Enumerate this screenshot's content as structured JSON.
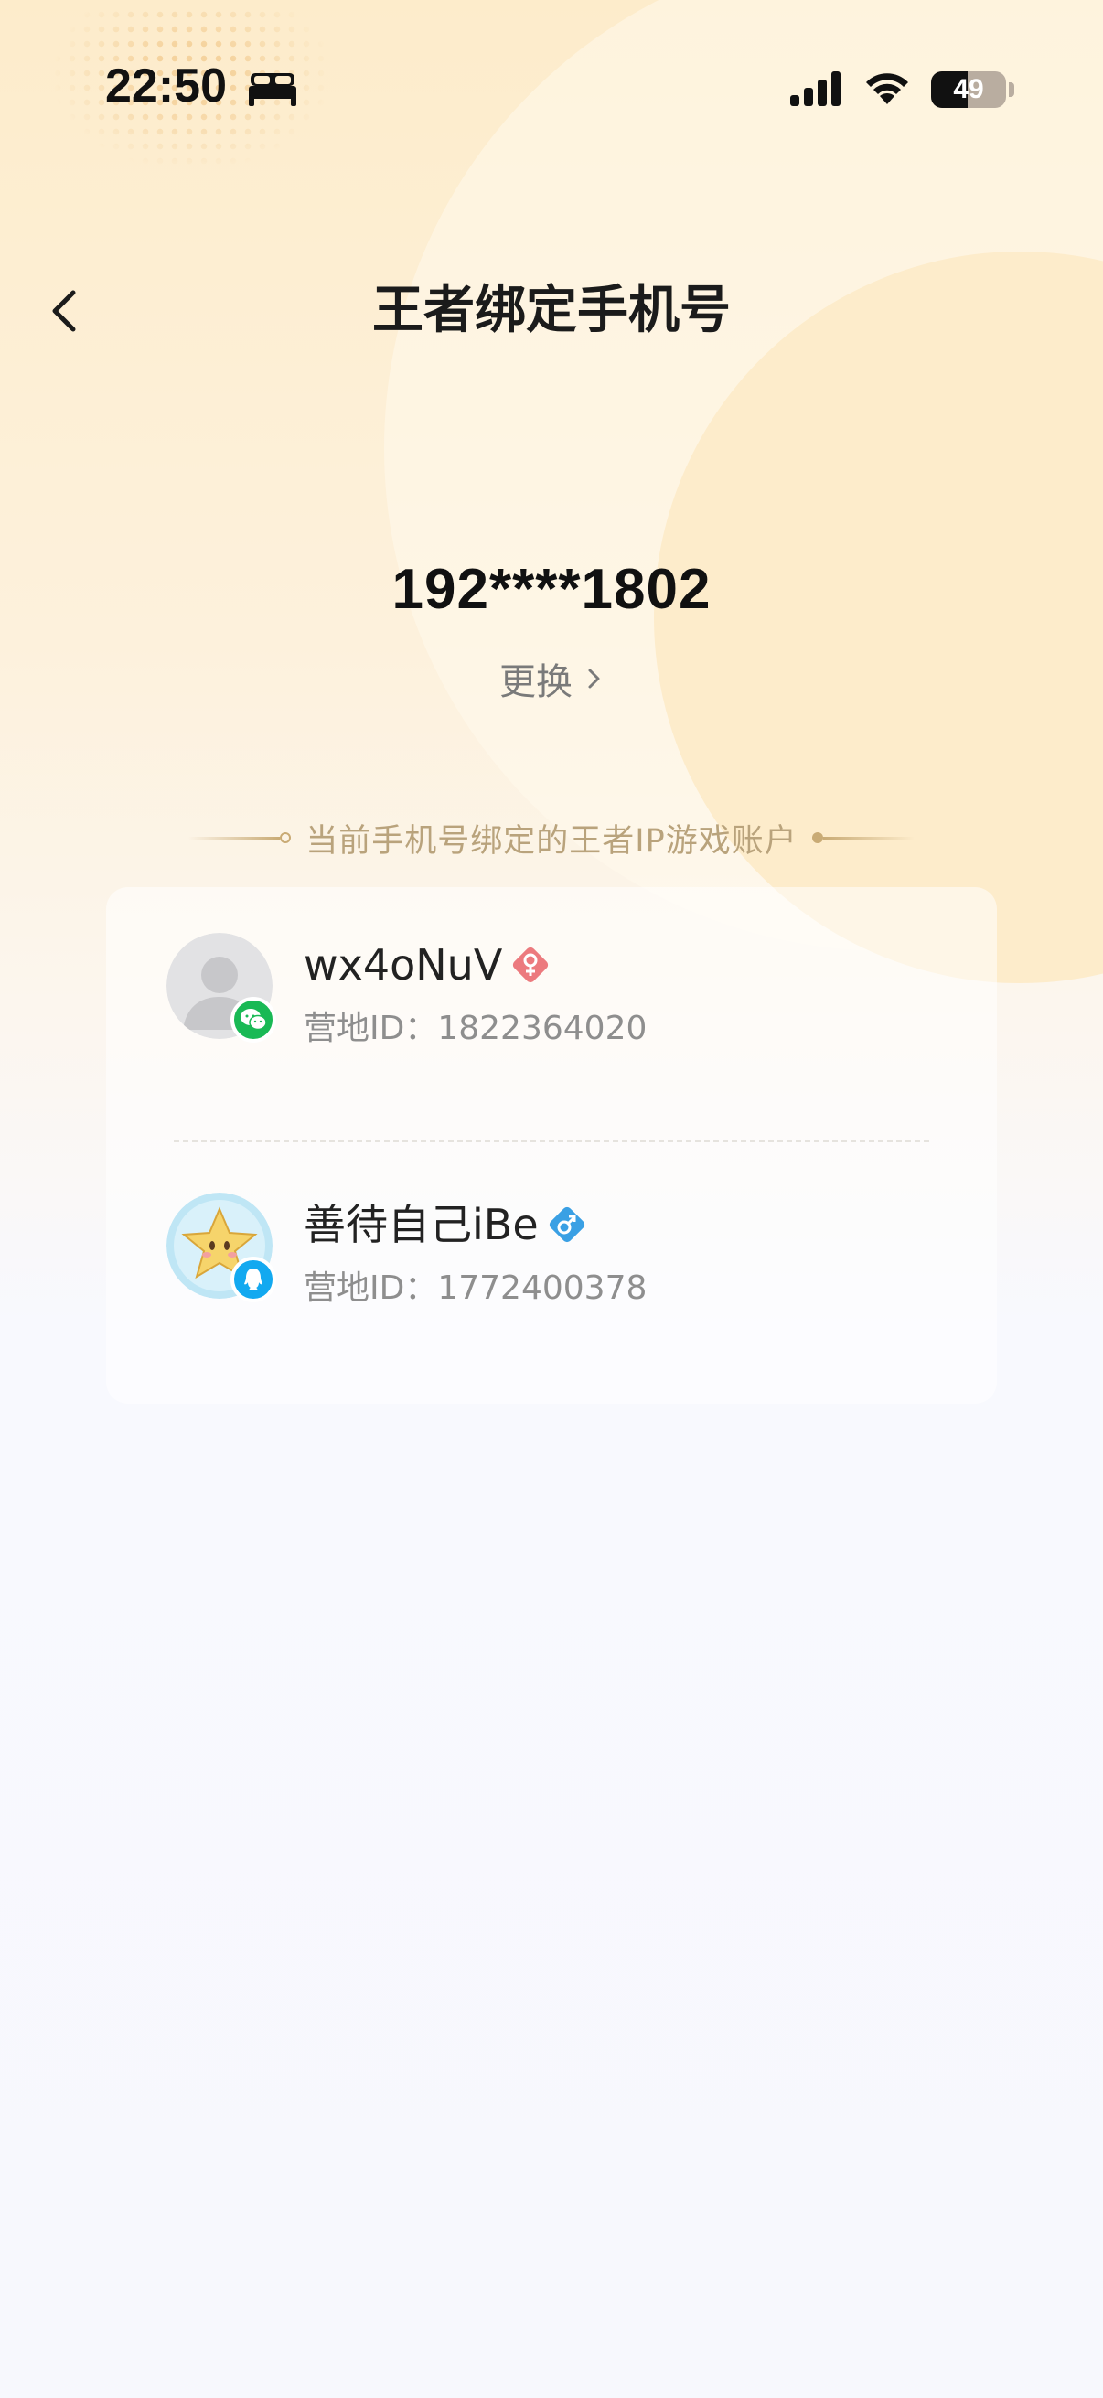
{
  "status_bar": {
    "time": "22:50",
    "sleep_icon": "bed-icon",
    "signal_icon": "cellular-signal-icon",
    "wifi_icon": "wifi-icon",
    "battery_level": "49",
    "battery_fraction": 0.49
  },
  "nav": {
    "back_icon": "chevron-left-icon",
    "title": "王者绑定手机号"
  },
  "phone": {
    "number": "192****1802",
    "change_label": "更换",
    "change_icon": "chevron-right-icon"
  },
  "section": {
    "title": "当前手机号绑定的王者IP游戏账户"
  },
  "accounts": [
    {
      "name": "wx4oNuV",
      "gender": "female",
      "gender_icon": "female-icon",
      "platform": "wechat",
      "platform_icon": "wechat-icon",
      "id_label": "营地ID：",
      "id_value": "1822364020",
      "avatar": "default-avatar"
    },
    {
      "name": "善待自己iBe",
      "gender": "male",
      "gender_icon": "male-icon",
      "platform": "qq",
      "platform_icon": "qq-icon",
      "id_label": "营地ID：",
      "id_value": "1772400378",
      "avatar": "star-avatar"
    }
  ],
  "colors": {
    "female": "#ec7a7e",
    "male": "#3aa0e4",
    "wechat": "#19b955",
    "qq": "#13a9f0",
    "accent_gold": "#c9ab75"
  }
}
